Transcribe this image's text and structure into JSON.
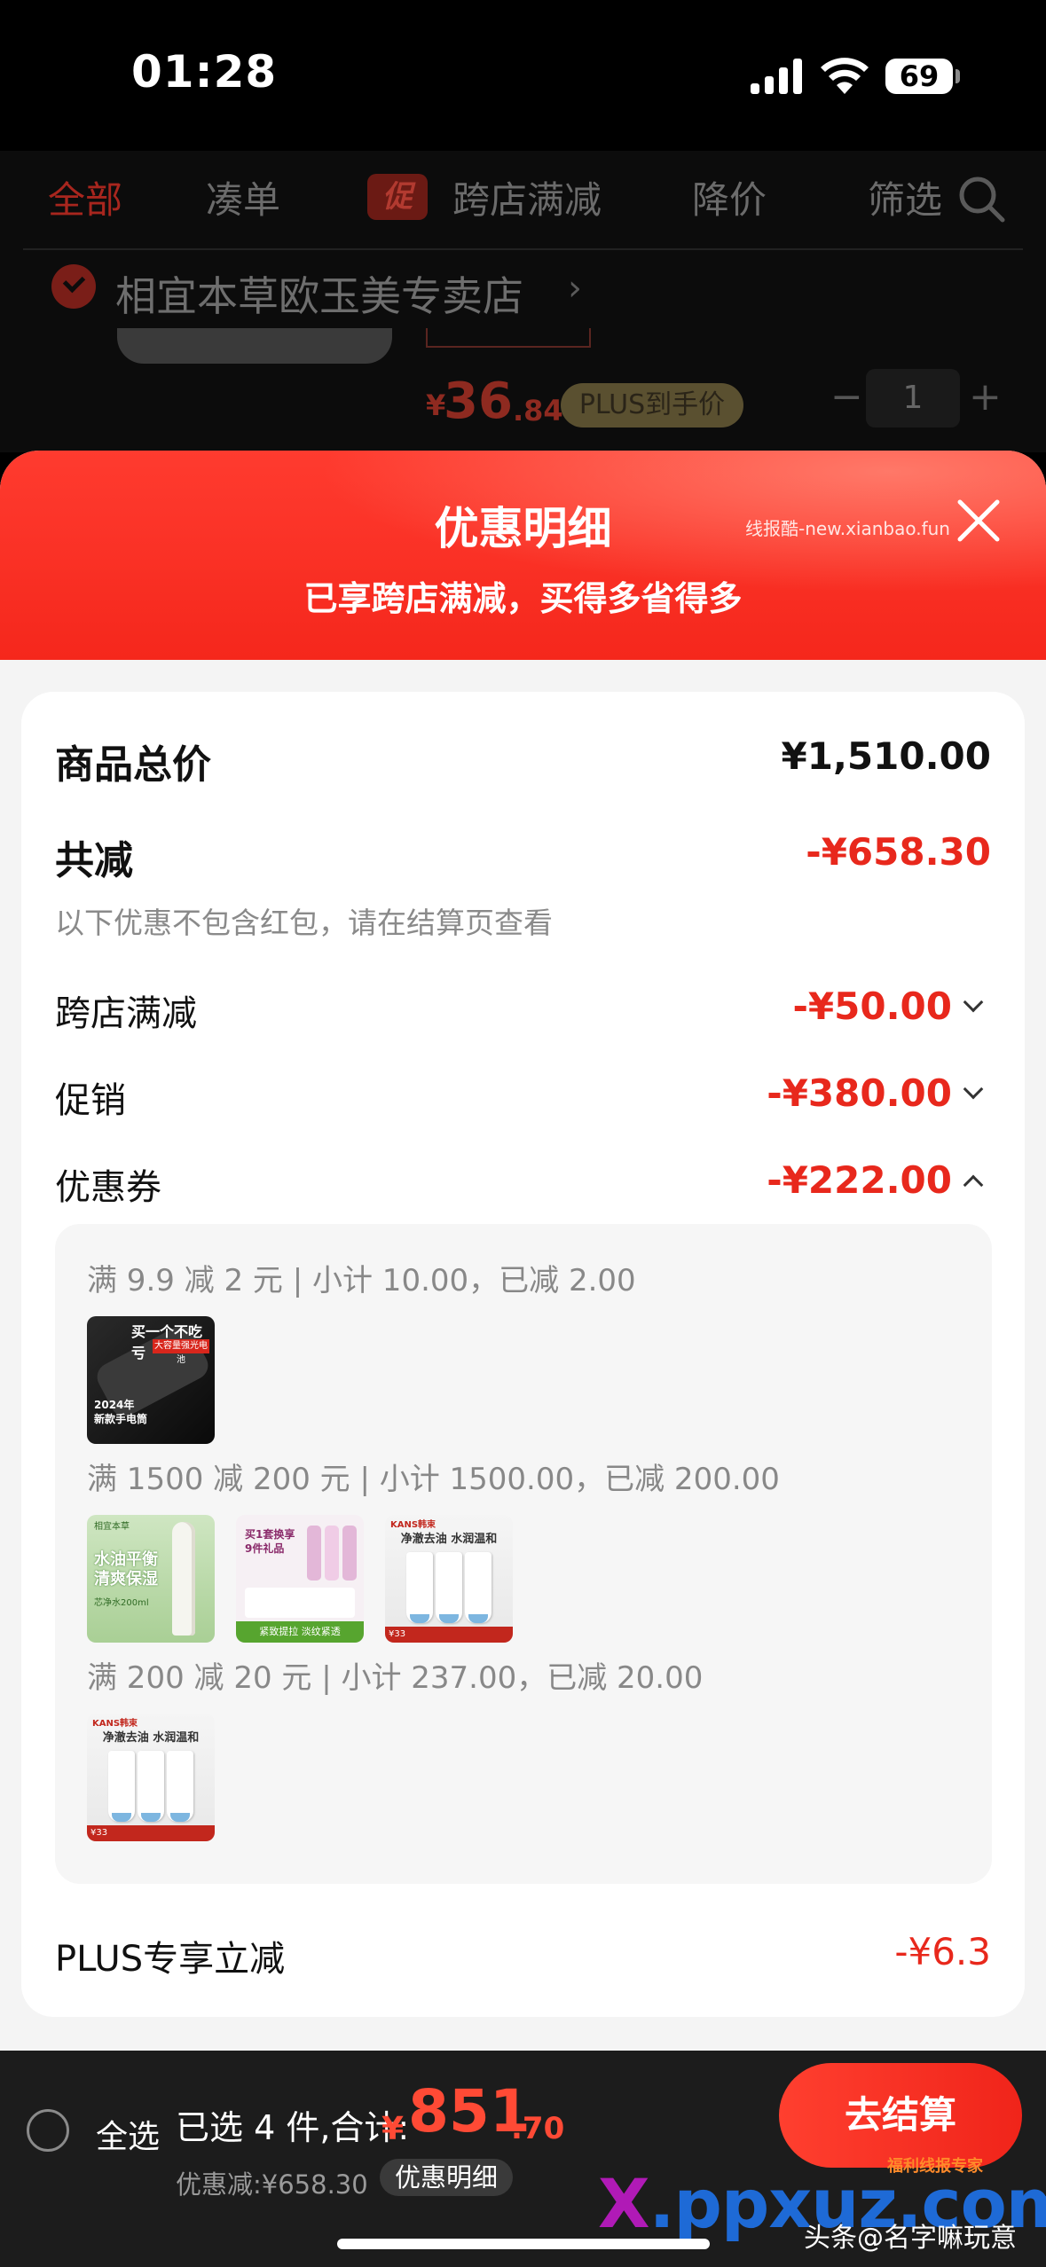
{
  "status_bar": {
    "time": "01:28",
    "battery": "69"
  },
  "filter_bar": {
    "tabs": [
      "全部",
      "凑单",
      "跨店满减",
      "降价",
      "筛选"
    ],
    "promo_tag": "促"
  },
  "store_row": {
    "name": "相宜本草欧玉美专卖店",
    "price_symbol": "¥",
    "price_int": "36",
    "price_dec": ".84",
    "plus_tag": "PLUS到手价",
    "quantity": "1"
  },
  "sheet": {
    "title": "优惠明细",
    "subtitle": "已享跨店满减，买得多省得多",
    "watermark": "线报酷-new.xianbao.fun"
  },
  "summary": {
    "goods_total_label": "商品总价",
    "goods_total_value": "¥1,510.00",
    "total_reduction_label": "共减",
    "total_reduction_value": "-¥658.30",
    "note": "以下优惠不包含红包，请在结算页查看",
    "cross_store_label": "跨店满减",
    "cross_store_value": "-¥50.00",
    "promo_label": "促销",
    "promo_value": "-¥380.00",
    "coupon_label": "优惠券",
    "coupon_value": "-¥222.00",
    "plus_label": "PLUS专享立减",
    "plus_value": "-¥6.3"
  },
  "coupon_tiers": [
    {
      "text": "满 9.9 减 2 元 | 小计 10.00，已减 2.00"
    },
    {
      "text": "满 1500 减 200 元 | 小计 1500.00，已减 200.00"
    },
    {
      "text": "满 200 减 20 元 | 小计 237.00，已减 20.00"
    }
  ],
  "products": {
    "flashlight": {
      "t1": "买一个不吃亏",
      "t2": "大容量强光电池",
      "t3": "2024年\n新款手电筒"
    },
    "green": {
      "brand": "相宜本草",
      "t1": "水油平衡\n清爽保湿",
      "t2": "芯净水200ml"
    },
    "pink": {
      "t1": "买1套换享\n9件礼品",
      "foot": "紧致提拉 淡纹紧透"
    },
    "tubes": {
      "brand": "KANS韩束",
      "t1": "净澈去油 水润温和",
      "foot": "¥33"
    }
  },
  "bottom_bar": {
    "select_all": "全选",
    "selected_summary": "已选 4 件,合计:",
    "total_symbol": "¥",
    "total_int": "851",
    "total_dec": ".70",
    "discount_text": "优惠减:¥658.30",
    "detail_chip": "优惠明细",
    "checkout": "去结算",
    "sticker": "福利线报专家",
    "logo_x": "X",
    "logo_rest": ".ppxuz.com",
    "credit": "头条@名字嘛玩意"
  },
  "colors": {
    "accent_red": "#f0241a",
    "discount_red": "#e8281c",
    "sheet_bg": "#f4f4f4",
    "bottom_bar": "#1c1c1c"
  }
}
